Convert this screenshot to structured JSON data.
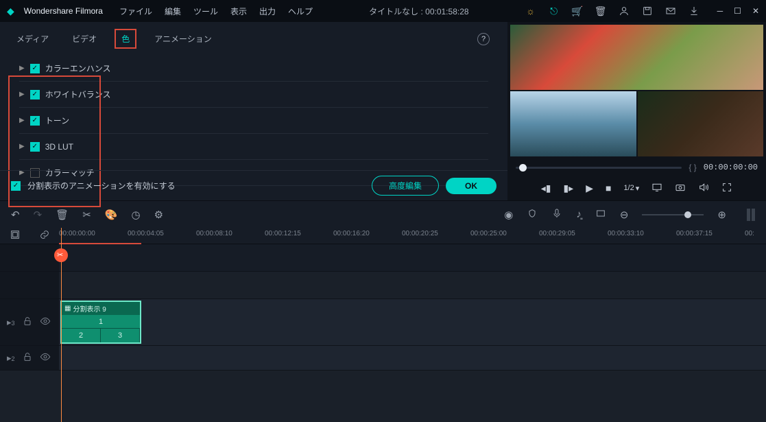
{
  "app": {
    "name": "Wondershare Filmora"
  },
  "menu": {
    "file": "ファイル",
    "edit": "編集",
    "tool": "ツール",
    "view": "表示",
    "output": "出力",
    "help": "ヘルプ"
  },
  "title": {
    "project": "タイトルなし",
    "sep": " : ",
    "duration": "00:01:58:28"
  },
  "tabs": {
    "media": "メディア",
    "video": "ビデオ",
    "color": "色",
    "animation": "アニメーション"
  },
  "props": {
    "colorEnhance": "カラーエンハンス",
    "whiteBalance": "ホワイトバランス",
    "tone": "トーン",
    "lut": "3D LUT",
    "colorMatch": "カラーマッチ"
  },
  "footer": {
    "splitAnim": "分割表示のアニメーションを有効にする",
    "advanced": "高度編集",
    "ok": "OK"
  },
  "preview": {
    "braces": "{        }",
    "timecode": "00:00:00:00",
    "speed": "1/2"
  },
  "ruler": {
    "t0": "00:00:00:00",
    "t1": "00:00:04:05",
    "t2": "00:00:08:10",
    "t3": "00:00:12:15",
    "t4": "00:00:16:20",
    "t5": "00:00:20:25",
    "t6": "00:00:25:00",
    "t7": "00:00:29:05",
    "t8": "00:00:33:10",
    "t9": "00:00:37:15",
    "t10": "00:"
  },
  "clip": {
    "title": "分割表示 9",
    "cell1": "1",
    "cell2": "2",
    "cell3": "3"
  },
  "tracks": {
    "t1": "3",
    "t2": "2"
  }
}
